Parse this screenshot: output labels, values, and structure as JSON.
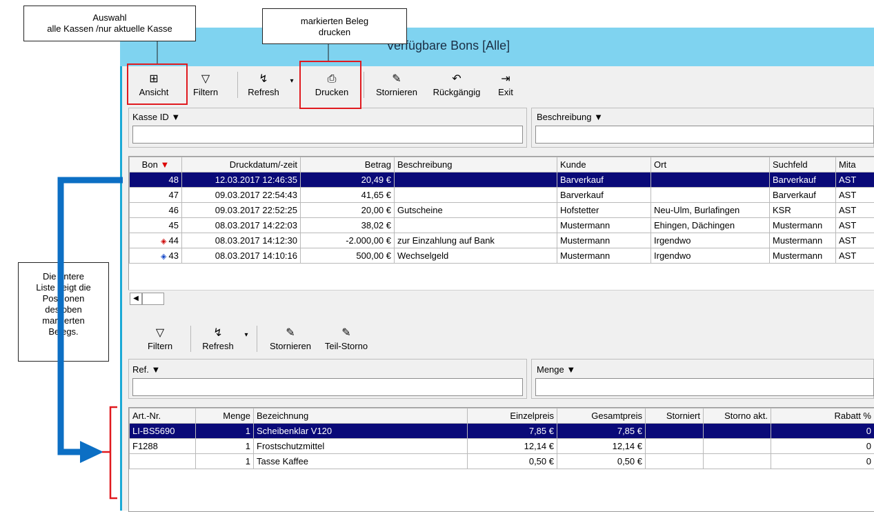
{
  "window": {
    "title": "Verfügbare Bons [Alle]"
  },
  "callouts": {
    "ansicht_line1": "Auswahl",
    "ansicht_line2": "alle Kassen /nur aktuelle Kasse",
    "drucken_line1": "markierten Beleg",
    "drucken_line2": "drucken",
    "lower_list_lines": [
      "Die untere",
      "Liste zeigt die",
      "Positionen",
      "des oben",
      "markierten",
      "Belegs."
    ]
  },
  "toolbar_top": {
    "ansicht": "Ansicht",
    "filtern": "Filtern",
    "refresh": "Refresh",
    "drucken": "Drucken",
    "stornieren": "Stornieren",
    "rueckgaengig": "Rückgängig",
    "exit": "Exit"
  },
  "filters_top": {
    "kasse_id": "Kasse ID ▼",
    "beschreibung": "Beschreibung ▼"
  },
  "bons_table": {
    "headers": [
      "Bon",
      "Druckdatum/-zeit",
      "Betrag",
      "Beschreibung",
      "Kunde",
      "Ort",
      "Suchfeld",
      "Mita"
    ],
    "sort_marker": "▼",
    "rows": [
      [
        "48",
        "12.03.2017 12:46:35",
        "20,49 €",
        "",
        "Barverkauf",
        "",
        "Barverkauf",
        "AST"
      ],
      [
        "47",
        "09.03.2017 22:54:43",
        "41,65 €",
        "",
        "Barverkauf",
        "",
        "Barverkauf",
        "AST"
      ],
      [
        "46",
        "09.03.2017 22:52:25",
        "20,00 €",
        "Gutscheine",
        "Hofstetter",
        "Neu-Ulm, Burlafingen",
        "KSR",
        "AST"
      ],
      [
        "45",
        "08.03.2017 14:22:03",
        "38,02 €",
        "",
        "Mustermann",
        "Ehingen, Dächingen",
        "Mustermann",
        "AST"
      ],
      [
        "44",
        "08.03.2017 14:12:30",
        "-2.000,00 €",
        "zur Einzahlung auf Bank",
        "Mustermann",
        "Irgendwo",
        "Mustermann",
        "AST"
      ],
      [
        "43",
        "08.03.2017 14:10:16",
        "500,00 €",
        "Wechselgeld",
        "Mustermann",
        "Irgendwo",
        "Mustermann",
        "AST"
      ]
    ]
  },
  "toolbar_bottom": {
    "filtern": "Filtern",
    "refresh": "Refresh",
    "stornieren": "Stornieren",
    "teil_storno": "Teil-Storno"
  },
  "filters_bottom": {
    "ref": "Ref. ▼",
    "menge": "Menge ▼"
  },
  "positions_table": {
    "headers": [
      "Art.-Nr.",
      "Menge",
      "Bezeichnung",
      "Einzelpreis",
      "Gesamtpreis",
      "Storniert",
      "Storno akt.",
      "Rabatt %"
    ],
    "rows": [
      [
        "LI-BS5690",
        "1",
        "Scheibenklar V120",
        "7,85 €",
        "7,85 €",
        "",
        "",
        "0"
      ],
      [
        "F1288",
        "1",
        "Frostschutzmittel",
        "12,14 €",
        "12,14 €",
        "",
        "",
        "0"
      ],
      [
        "",
        "1",
        "Tasse Kaffee",
        "0,50 €",
        "0,50 €",
        "",
        "",
        "0"
      ]
    ]
  },
  "colors": {
    "selection": "#0a0a78",
    "titlebar": "#7fd3f0",
    "highlight_red": "#e0191e",
    "arrow_blue": "#0c6fc4"
  }
}
